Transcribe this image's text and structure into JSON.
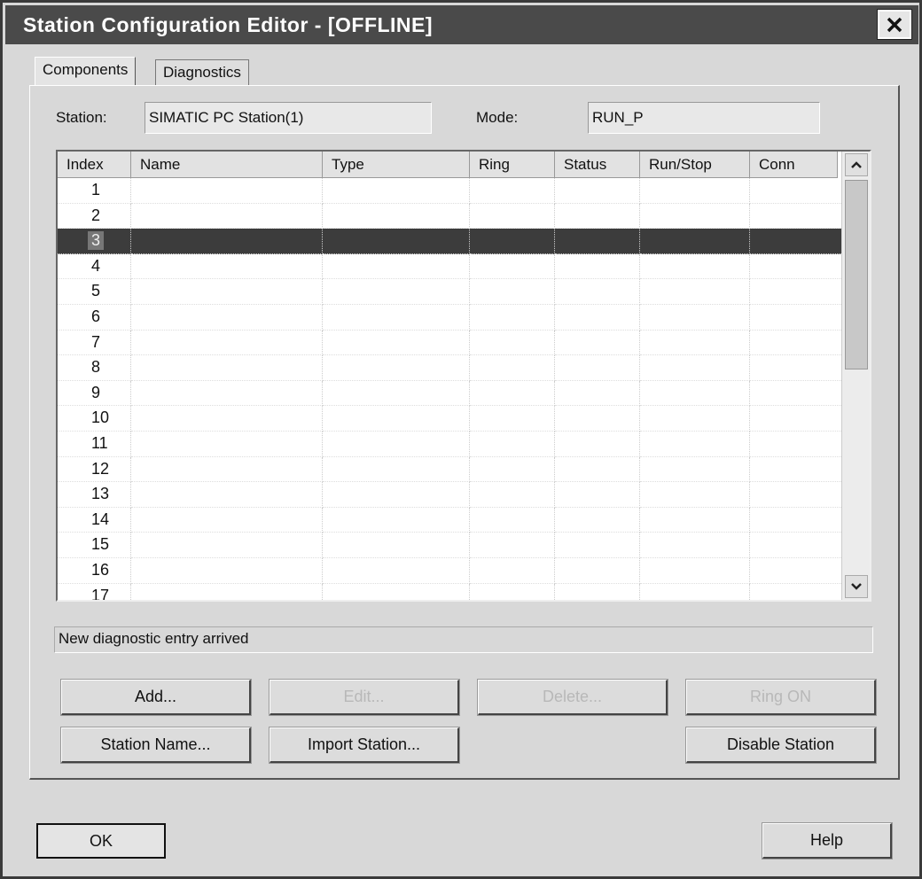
{
  "window": {
    "title": "Station Configuration Editor - [OFFLINE]"
  },
  "tabs": [
    {
      "label": "Components",
      "active": true
    },
    {
      "label": "Diagnostics",
      "active": false
    }
  ],
  "station": {
    "label": "Station:",
    "value": "SIMATIC PC Station(1)"
  },
  "mode": {
    "label": "Mode:",
    "value": "RUN_P"
  },
  "table": {
    "columns": [
      "Index",
      "Name",
      "Type",
      "Ring",
      "Status",
      "Run/Stop",
      "Conn"
    ],
    "rows": [
      "1",
      "2",
      "3",
      "4",
      "5",
      "6",
      "7",
      "8",
      "9",
      "10",
      "11",
      "12",
      "13",
      "14",
      "15",
      "16",
      "17"
    ],
    "selected_index": "3"
  },
  "status_text": "New diagnostic entry arrived",
  "buttons": {
    "add": "Add...",
    "edit": "Edit...",
    "delete": "Delete...",
    "ring_on": "Ring ON",
    "station_name": "Station Name...",
    "import_station": "Import Station...",
    "disable_station": "Disable Station",
    "ok": "OK",
    "help": "Help"
  },
  "colors": {
    "titlebar": "#4a4a4a",
    "selection": "#3c3c3c",
    "face": "#d8d8d8"
  }
}
